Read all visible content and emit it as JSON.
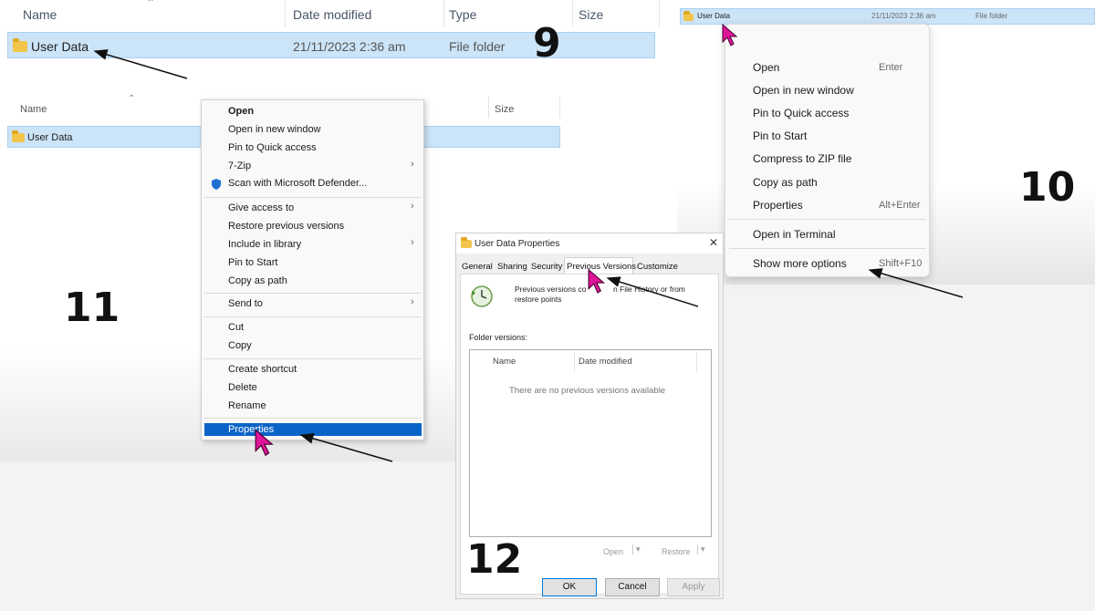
{
  "explorer_top": {
    "headers": {
      "name": "Name",
      "date": "Date modified",
      "type": "Type",
      "size": "Size"
    },
    "row": {
      "name": "User Data",
      "date": "21/11/2023 2:36 am",
      "type": "File folder"
    }
  },
  "steps": {
    "s9": "9",
    "s10": "10",
    "s11": "11",
    "s12": "12"
  },
  "explorer_mid": {
    "headers": {
      "name": "Name",
      "size": "Size"
    },
    "row": {
      "name": "User Data"
    }
  },
  "classic_menu": {
    "items": [
      "Open",
      "Open in new window",
      "Pin to Quick access",
      "7-Zip",
      "Scan with Microsoft Defender...",
      "Give access to",
      "Restore previous versions",
      "Include in library",
      "Pin to Start",
      "Copy as path",
      "Send to",
      "Cut",
      "Copy",
      "Create shortcut",
      "Delete",
      "Rename",
      "Properties"
    ]
  },
  "explorer_right": {
    "row": {
      "name": "User Data",
      "date": "21/11/2023 2:36 am",
      "type": "File folder"
    }
  },
  "w11_menu": {
    "items": [
      {
        "label": "Open",
        "shortcut": "Enter"
      },
      {
        "label": "Open in new window",
        "shortcut": ""
      },
      {
        "label": "Pin to Quick access",
        "shortcut": ""
      },
      {
        "label": "Pin to Start",
        "shortcut": ""
      },
      {
        "label": "Compress to ZIP file",
        "shortcut": ""
      },
      {
        "label": "Copy as path",
        "shortcut": ""
      },
      {
        "label": "Properties",
        "shortcut": "Alt+Enter"
      },
      {
        "label": "Open in Terminal",
        "shortcut": ""
      },
      {
        "label": "Show more options",
        "shortcut": "Shift+F10"
      }
    ]
  },
  "dialog": {
    "title": "User Data Properties",
    "close": "✕",
    "tabs": [
      "General",
      "Sharing",
      "Security",
      "Previous Versions",
      "Customize"
    ],
    "info_line1": "Previous versions co",
    "info_line1b": "n File History or from",
    "info_line2": "restore points",
    "folder_versions_label": "Folder versions:",
    "col_name": "Name",
    "col_date": "Date modified",
    "empty_text": "There are no previous versions available",
    "open_btn": "Open",
    "restore_btn": "Restore",
    "ok": "OK",
    "cancel": "Cancel",
    "apply": "Apply"
  },
  "colors": {
    "selection": "#cce4f7",
    "highlight": "#0a64c8",
    "cursor": "#e0169a",
    "defender_shield": "#1f6fd1"
  }
}
